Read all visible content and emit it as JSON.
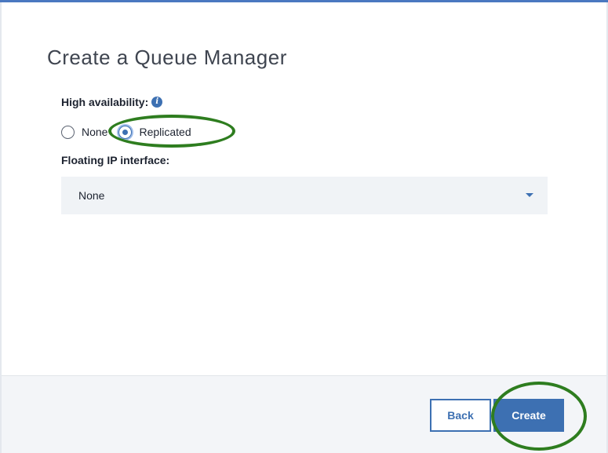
{
  "dialog": {
    "title": "Create a Queue Manager"
  },
  "high_availability": {
    "label": "High availability:",
    "info_icon": "info-icon",
    "options": [
      {
        "label": "None",
        "selected": false
      },
      {
        "label": "Replicated",
        "selected": true
      }
    ]
  },
  "floating_ip": {
    "label": "Floating IP interface:",
    "selected_value": "None"
  },
  "footer": {
    "back_label": "Back",
    "create_label": "Create"
  },
  "colors": {
    "accent": "#3d70b2",
    "annotation": "#2e7d1f",
    "top_border": "#4a78c0"
  }
}
